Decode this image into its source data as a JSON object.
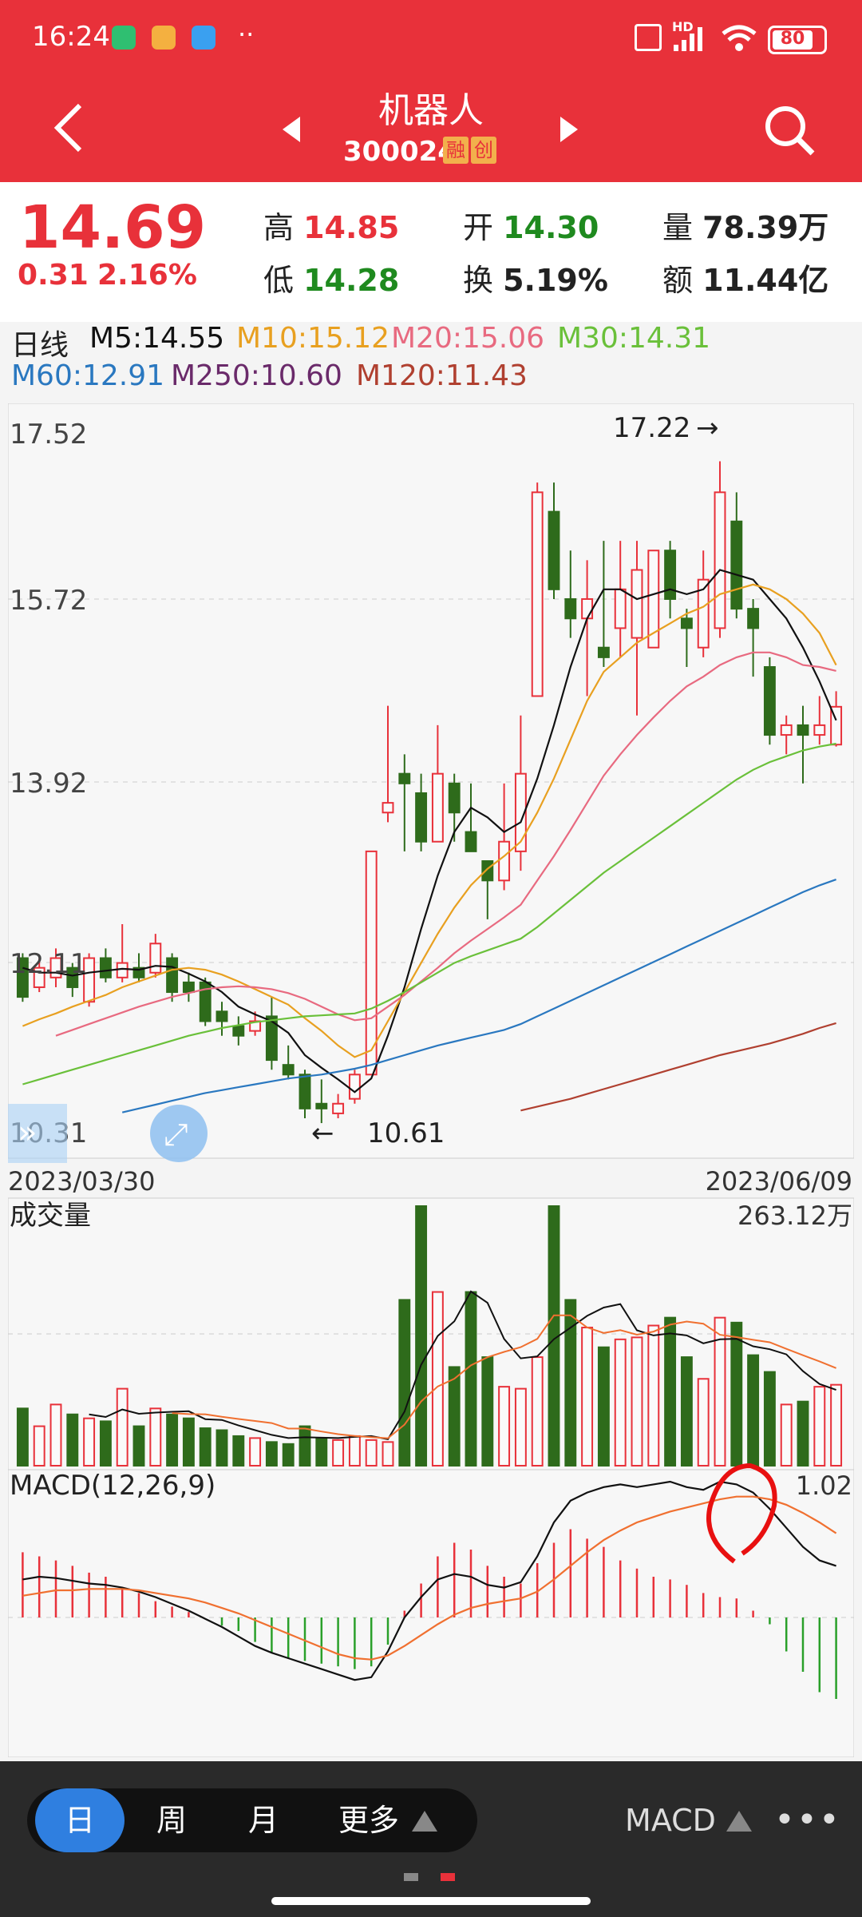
{
  "status": {
    "time": "16:24",
    "battery": "80",
    "signal": "HD"
  },
  "header": {
    "title": "机器人",
    "code": "300024",
    "tag1": "融",
    "tag2": "创"
  },
  "quote": {
    "price": "14.69",
    "change": "0.31",
    "change_pct": "2.16%",
    "high_label": "高",
    "high": "14.85",
    "low_label": "低",
    "low": "14.28",
    "open_label": "开",
    "open": "14.30",
    "turnover_label": "换",
    "turnover": "5.19%",
    "volume_label": "量",
    "volume": "78.39万",
    "amount_label": "额",
    "amount": "11.44亿"
  },
  "ma_legend": {
    "period": "日线",
    "m5": "M5:14.55",
    "m10": "M10:15.12",
    "m20": "M20:15.06",
    "m30": "M30:14.31",
    "m60": "M60:12.91",
    "m250": "M250:10.60",
    "m120": "M120:11.43"
  },
  "colors": {
    "up": "#e8313a",
    "down": "#2e6b1b",
    "m5": "#111111",
    "m10": "#e8a020",
    "m20": "#e86a80",
    "m30": "#6ac03a",
    "m60": "#2a78c0",
    "m250": "#6a2a6a",
    "m120": "#b04030",
    "accent": "#2f7fe0"
  },
  "chart_data": {
    "type": "candlestick",
    "price_axis_labels": [
      "17.52",
      "15.72",
      "13.92",
      "12.11",
      "10.31"
    ],
    "ylim": [
      10.31,
      17.52
    ],
    "high_marker": "17.22",
    "low_marker": "10.61",
    "start_date": "2023/03/30",
    "end_date": "2023/06/09",
    "candles": [
      [
        12.1,
        11.7,
        12.15,
        11.65
      ],
      [
        11.8,
        12.0,
        12.1,
        11.75
      ],
      [
        11.9,
        12.1,
        12.2,
        11.8
      ],
      [
        12.0,
        11.8,
        12.05,
        11.7
      ],
      [
        11.65,
        12.1,
        12.15,
        11.6
      ],
      [
        12.1,
        11.9,
        12.2,
        11.85
      ],
      [
        11.9,
        12.05,
        12.45,
        11.85
      ],
      [
        12.0,
        11.9,
        12.15,
        11.85
      ],
      [
        11.95,
        12.25,
        12.35,
        11.9
      ],
      [
        12.1,
        11.75,
        12.15,
        11.65
      ],
      [
        11.85,
        11.75,
        11.95,
        11.65
      ],
      [
        11.85,
        11.45,
        11.9,
        11.4
      ],
      [
        11.55,
        11.45,
        11.65,
        11.3
      ],
      [
        11.4,
        11.3,
        11.5,
        11.2
      ],
      [
        11.35,
        11.45,
        11.55,
        11.3
      ],
      [
        11.5,
        11.05,
        11.7,
        10.95
      ],
      [
        11.0,
        10.9,
        11.2,
        10.85
      ],
      [
        10.9,
        10.55,
        10.95,
        10.45
      ],
      [
        10.6,
        10.55,
        10.85,
        10.4
      ],
      [
        10.5,
        10.6,
        10.7,
        10.45
      ],
      [
        10.65,
        10.9,
        10.95,
        10.6
      ],
      [
        10.9,
        13.2,
        13.2,
        10.9
      ],
      [
        13.6,
        13.7,
        14.7,
        13.5
      ],
      [
        14.0,
        13.9,
        14.2,
        13.2
      ],
      [
        13.8,
        13.3,
        14.0,
        13.2
      ],
      [
        13.3,
        14.0,
        14.5,
        13.3
      ],
      [
        13.9,
        13.6,
        14.0,
        13.3
      ],
      [
        13.4,
        13.2,
        13.9,
        13.2
      ],
      [
        13.1,
        12.9,
        13.1,
        12.5
      ],
      [
        12.9,
        13.3,
        13.9,
        12.8
      ],
      [
        13.2,
        14.0,
        14.6,
        13.0
      ],
      [
        14.8,
        16.9,
        17.0,
        14.8
      ],
      [
        16.7,
        15.9,
        17.0,
        15.8
      ],
      [
        15.8,
        15.6,
        16.3,
        15.4
      ],
      [
        15.6,
        15.8,
        16.2,
        14.8
      ],
      [
        15.3,
        15.2,
        16.4,
        15.1
      ],
      [
        15.5,
        15.9,
        16.4,
        15.2
      ],
      [
        15.4,
        16.1,
        16.4,
        14.6
      ],
      [
        15.3,
        16.3,
        16.3,
        15.3
      ],
      [
        16.3,
        15.8,
        16.4,
        15.6
      ],
      [
        15.6,
        15.5,
        15.7,
        15.1
      ],
      [
        15.3,
        16.0,
        16.3,
        15.2
      ],
      [
        15.5,
        16.9,
        17.22,
        15.4
      ],
      [
        16.6,
        15.7,
        16.9,
        15.6
      ],
      [
        15.7,
        15.5,
        15.8,
        15.0
      ],
      [
        15.1,
        14.4,
        15.2,
        14.3
      ],
      [
        14.4,
        14.5,
        14.6,
        14.2
      ],
      [
        14.5,
        14.4,
        14.7,
        13.9
      ],
      [
        14.4,
        14.5,
        14.8,
        14.3
      ],
      [
        14.3,
        14.69,
        14.85,
        14.28
      ]
    ],
    "ma_lines": {
      "m5": [
        12.0,
        11.95,
        11.95,
        11.92,
        11.95,
        11.97,
        11.99,
        11.98,
        12.02,
        12.01,
        11.94,
        11.86,
        11.75,
        11.6,
        11.52,
        11.45,
        11.33,
        11.1,
        10.97,
        10.85,
        10.72,
        10.86,
        11.3,
        11.8,
        12.4,
        12.95,
        13.4,
        13.65,
        13.55,
        13.4,
        13.5,
        13.95,
        14.5,
        15.1,
        15.6,
        15.9,
        15.9,
        15.8,
        15.85,
        15.9,
        15.85,
        15.9,
        16.1,
        16.05,
        16.0,
        15.8,
        15.6,
        15.3,
        14.95,
        14.55
      ],
      "m10": [
        11.4,
        11.47,
        11.53,
        11.6,
        11.66,
        11.72,
        11.8,
        11.86,
        11.92,
        11.98,
        12.0,
        11.98,
        11.93,
        11.86,
        11.78,
        11.7,
        11.62,
        11.48,
        11.35,
        11.2,
        11.08,
        11.15,
        11.45,
        11.75,
        12.05,
        12.35,
        12.62,
        12.85,
        13.02,
        13.15,
        13.3,
        13.6,
        13.95,
        14.35,
        14.75,
        15.05,
        15.2,
        15.35,
        15.45,
        15.55,
        15.65,
        15.72,
        15.85,
        15.9,
        15.95,
        15.9,
        15.8,
        15.65,
        15.45,
        15.12
      ],
      "m20": [
        null,
        null,
        11.3,
        11.36,
        11.42,
        11.48,
        11.54,
        11.6,
        11.65,
        11.7,
        11.74,
        11.78,
        11.8,
        11.81,
        11.8,
        11.78,
        11.74,
        11.68,
        11.6,
        11.52,
        11.46,
        11.48,
        11.6,
        11.72,
        11.86,
        12.0,
        12.15,
        12.28,
        12.4,
        12.52,
        12.65,
        12.9,
        13.15,
        13.42,
        13.7,
        13.98,
        14.2,
        14.4,
        14.58,
        14.75,
        14.9,
        15.0,
        15.12,
        15.2,
        15.25,
        15.25,
        15.2,
        15.12,
        15.1,
        15.06
      ],
      "m30": [
        10.8,
        10.85,
        10.9,
        10.95,
        11.0,
        11.05,
        11.1,
        11.15,
        11.2,
        11.25,
        11.3,
        11.34,
        11.38,
        11.41,
        11.44,
        11.46,
        11.48,
        11.5,
        11.51,
        11.52,
        11.53,
        11.58,
        11.66,
        11.75,
        11.85,
        11.95,
        12.05,
        12.12,
        12.18,
        12.24,
        12.3,
        12.42,
        12.56,
        12.7,
        12.84,
        12.98,
        13.1,
        13.22,
        13.34,
        13.46,
        13.58,
        13.7,
        13.82,
        13.94,
        14.04,
        14.12,
        14.18,
        14.24,
        14.28,
        14.31
      ],
      "m60": [
        null,
        null,
        null,
        null,
        null,
        null,
        10.51,
        10.55,
        10.59,
        10.63,
        10.67,
        10.71,
        10.74,
        10.77,
        10.8,
        10.83,
        10.86,
        10.88,
        10.9,
        10.93,
        10.96,
        11.0,
        11.05,
        11.1,
        11.15,
        11.2,
        11.24,
        11.28,
        11.32,
        11.36,
        11.42,
        11.5,
        11.58,
        11.66,
        11.74,
        11.82,
        11.9,
        11.98,
        12.06,
        12.14,
        12.22,
        12.3,
        12.38,
        12.46,
        12.54,
        12.62,
        12.7,
        12.78,
        12.85,
        12.91
      ],
      "m250": [
        null,
        null,
        null,
        null,
        null,
        null,
        null,
        null,
        null,
        null,
        null,
        null,
        null,
        null,
        null,
        null,
        null,
        null,
        null,
        null,
        null,
        null,
        null,
        null,
        null,
        null,
        null,
        null,
        null,
        null,
        10.53,
        10.57,
        10.61,
        10.65,
        10.7,
        10.75,
        10.8,
        10.85,
        10.9,
        10.95,
        11.0,
        11.05,
        11.1,
        11.14,
        11.18,
        11.22,
        11.27,
        11.32,
        11.38,
        11.43
      ]
    },
    "volume": {
      "label": "成交量",
      "max_label": "263.12万",
      "values": [
        58,
        40,
        62,
        52,
        48,
        45,
        78,
        40,
        58,
        52,
        48,
        38,
        36,
        30,
        28,
        24,
        22,
        40,
        28,
        26,
        30,
        26,
        24,
        168,
        263,
        176,
        100,
        176,
        110,
        80,
        78,
        110,
        263,
        168,
        140,
        120,
        128,
        130,
        142,
        150,
        110,
        88,
        150,
        145,
        112,
        95,
        62,
        65,
        80,
        82
      ]
    },
    "macd": {
      "label": "MACD(12,26,9)",
      "max_label": "1.02",
      "histogram": [
        0.48,
        0.45,
        0.42,
        0.38,
        0.33,
        0.3,
        0.22,
        0.18,
        0.12,
        0.08,
        0.04,
        0.0,
        -0.06,
        -0.1,
        -0.18,
        -0.26,
        -0.3,
        -0.32,
        -0.34,
        -0.36,
        -0.38,
        -0.36,
        -0.2,
        0.05,
        0.25,
        0.45,
        0.55,
        0.5,
        0.38,
        0.3,
        0.25,
        0.4,
        0.55,
        0.65,
        0.58,
        0.52,
        0.42,
        0.36,
        0.3,
        0.28,
        0.24,
        0.18,
        0.15,
        0.14,
        0.05,
        -0.05,
        -0.25,
        -0.4,
        -0.55,
        -0.6
      ],
      "dif": [
        0.28,
        0.3,
        0.29,
        0.27,
        0.25,
        0.24,
        0.22,
        0.19,
        0.15,
        0.1,
        0.05,
        -0.01,
        -0.07,
        -0.14,
        -0.21,
        -0.26,
        -0.3,
        -0.34,
        -0.38,
        -0.42,
        -0.46,
        -0.44,
        -0.25,
        0.0,
        0.15,
        0.28,
        0.32,
        0.3,
        0.24,
        0.22,
        0.26,
        0.45,
        0.7,
        0.86,
        0.92,
        0.96,
        0.98,
        0.96,
        0.98,
        1.0,
        0.96,
        0.94,
        1.0,
        0.98,
        0.92,
        0.8,
        0.66,
        0.52,
        0.42,
        0.38
      ],
      "dea": [
        0.16,
        0.18,
        0.2,
        0.2,
        0.21,
        0.21,
        0.21,
        0.2,
        0.18,
        0.16,
        0.14,
        0.11,
        0.07,
        0.03,
        -0.02,
        -0.07,
        -0.12,
        -0.17,
        -0.22,
        -0.27,
        -0.3,
        -0.31,
        -0.28,
        -0.21,
        -0.13,
        -0.05,
        0.02,
        0.07,
        0.1,
        0.12,
        0.14,
        0.19,
        0.28,
        0.38,
        0.48,
        0.57,
        0.64,
        0.7,
        0.74,
        0.78,
        0.81,
        0.84,
        0.87,
        0.89,
        0.89,
        0.87,
        0.83,
        0.77,
        0.7,
        0.62
      ]
    }
  },
  "bottom": {
    "tabs": [
      "日",
      "周",
      "月",
      "更多"
    ],
    "indicator": "MACD"
  }
}
